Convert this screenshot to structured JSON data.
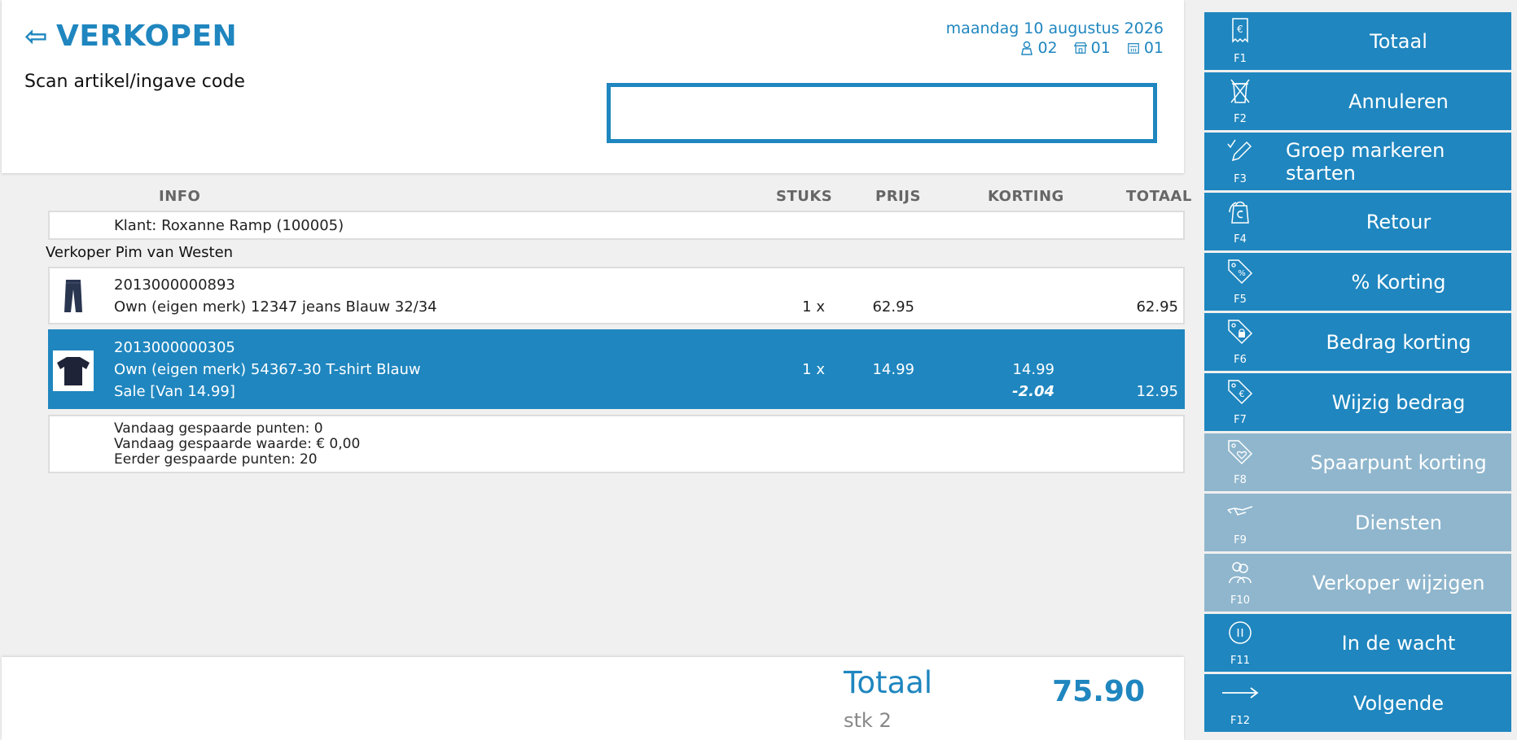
{
  "header": {
    "title": "VERKOPEN",
    "back_icon": "left-arrow-icon",
    "scan_label": "Scan artikel/ingave code",
    "scan_value": "",
    "date": "maandag 10 augustus 2026",
    "counters": [
      {
        "icon": "user-icon",
        "value": "02"
      },
      {
        "icon": "store-icon",
        "value": "01"
      },
      {
        "icon": "register-icon",
        "value": "01"
      }
    ]
  },
  "table": {
    "columns": {
      "info": "INFO",
      "stuks": "STUKS",
      "prijs": "PRIJS",
      "korting": "KORTING",
      "totaal": "TOTAAL"
    },
    "klant": "Klant: Roxanne Ramp (100005)",
    "verkoper": "Verkoper Pim van Westen",
    "items": [
      {
        "code": "2013000000893",
        "description": "Own (eigen merk) 12347 jeans Blauw 32/34",
        "stuks": "1 x",
        "prijs": "62.95",
        "totaal": "62.95",
        "image": "jeans-icon"
      },
      {
        "code": "2013000000305",
        "description": "Own (eigen merk) 54367-30 T-shirt Blauw",
        "sale": "Sale [Van 14.99]",
        "stuks": "1 x",
        "prijs": "14.99",
        "korting_orig": "14.99",
        "korting": "-2.04",
        "totaal": "12.95",
        "image": "tshirt-icon",
        "selected": true
      }
    ],
    "points": {
      "today_points": "Vandaag gespaarde punten: 0",
      "today_value": "Vandaag gespaarde waarde: € 0,00",
      "earlier_points": "Eerder gespaarde punten: 20"
    }
  },
  "footer": {
    "total_label": "Totaal",
    "total_value": "75.90",
    "stk": "stk 2"
  },
  "fkeys": [
    {
      "key": "F1",
      "label": "Totaal",
      "icon": "receipt-euro-icon",
      "enabled": true
    },
    {
      "key": "F2",
      "label": "Annuleren",
      "icon": "cancel-bin-icon",
      "enabled": true
    },
    {
      "key": "F3",
      "label": "Groep markeren starten",
      "icon": "pencil-check-icon",
      "enabled": true
    },
    {
      "key": "F4",
      "label": "Retour",
      "icon": "return-bag-icon",
      "enabled": true
    },
    {
      "key": "F5",
      "label": "% Korting",
      "icon": "percent-tag-icon",
      "enabled": true
    },
    {
      "key": "F6",
      "label": "Bedrag korting",
      "icon": "amount-tag-icon",
      "enabled": true
    },
    {
      "key": "F7",
      "label": "Wijzig bedrag",
      "icon": "euro-tag-icon",
      "enabled": true
    },
    {
      "key": "F8",
      "label": "Spaarpunt korting",
      "icon": "heart-tag-icon",
      "enabled": false
    },
    {
      "key": "F9",
      "label": "Diensten",
      "icon": "service-hand-icon",
      "enabled": false
    },
    {
      "key": "F10",
      "label": "Verkoper wijzigen",
      "icon": "users-icon",
      "enabled": false
    },
    {
      "key": "F11",
      "label": "In de wacht",
      "icon": "pause-icon",
      "enabled": true
    },
    {
      "key": "F12",
      "label": "Volgende",
      "icon": "right-arrow-icon",
      "enabled": true
    }
  ],
  "colors": {
    "accent": "#1f86bf",
    "disabled": "#8fb6cd",
    "background": "#f0f0f0"
  }
}
